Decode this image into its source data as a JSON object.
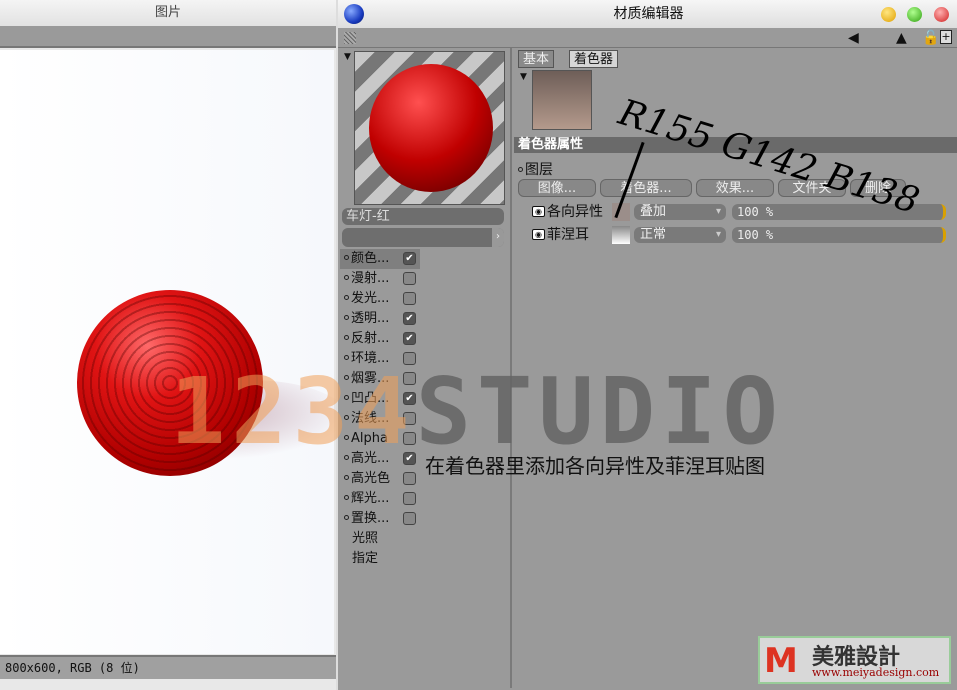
{
  "left_window": {
    "title": "图片",
    "status": "800x600, RGB (8 位)"
  },
  "material_editor": {
    "title": "材质编辑器",
    "material_name": "车灯-红",
    "channels": [
      {
        "label": "颜色...",
        "checked": true
      },
      {
        "label": "漫射...",
        "checked": false
      },
      {
        "label": "发光...",
        "checked": false
      },
      {
        "label": "透明...",
        "checked": true
      },
      {
        "label": "反射...",
        "checked": true
      },
      {
        "label": "环境...",
        "checked": false
      },
      {
        "label": "烟雾...",
        "checked": false
      },
      {
        "label": "凹凸...",
        "checked": true
      },
      {
        "label": "法线...",
        "checked": false
      },
      {
        "label": "Alpha",
        "checked": false
      },
      {
        "label": "高光...",
        "checked": true
      },
      {
        "label": "高光色",
        "checked": false
      },
      {
        "label": "辉光...",
        "checked": false
      },
      {
        "label": "置换...",
        "checked": false
      }
    ],
    "extra_items": [
      "光照",
      "指定"
    ],
    "tabs": [
      "基本",
      "着色器"
    ],
    "section_header": "着色器属性",
    "layer_label": "图层",
    "buttons": [
      "图像...",
      "着色器...",
      "效果...",
      "文件夹",
      "删除"
    ],
    "layers": [
      {
        "name": "各向异性",
        "mode": "叠加",
        "opacity": "100 %",
        "swatch": "#9b8e8a"
      },
      {
        "name": "菲涅耳",
        "mode": "正常",
        "opacity": "100 %",
        "swatch": "#cccccc"
      }
    ]
  },
  "overlay": {
    "watermark_a": "1234",
    "watermark_b": "STUDIO",
    "caption": "在着色器里添加各向异性及菲涅耳贴图",
    "handwriting": "R155 G142 B138"
  },
  "brand": {
    "logo": "M",
    "name": "美雅設計",
    "url": "www.meiyadesign.com"
  }
}
